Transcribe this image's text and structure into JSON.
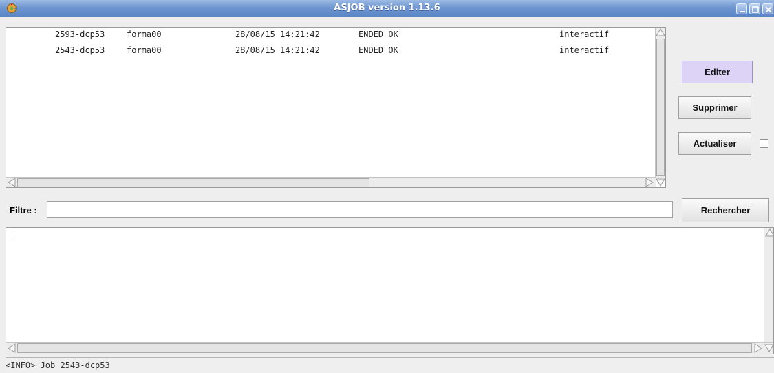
{
  "window": {
    "title": "ASJOB version 1.13.6",
    "controls": [
      "minimize-icon",
      "maximize-icon",
      "close-icon"
    ]
  },
  "jobs": [
    {
      "id": "2593-dcp53",
      "user": "forma00",
      "date": "28/08/15 14:21:42",
      "status": "ENDED OK",
      "mode": "interactif"
    },
    {
      "id": "2543-dcp53",
      "user": "forma00",
      "date": "28/08/15 14:21:42",
      "status": "ENDED OK",
      "mode": "interactif"
    }
  ],
  "actions": {
    "edit": "Editer",
    "delete": "Supprimer",
    "refresh": "Actualiser"
  },
  "filter": {
    "label": "Filtre :",
    "value": "",
    "search_button": "Rechercher"
  },
  "output": {
    "text": ""
  },
  "status_bar": {
    "message": "<INFO> Job 2543-dcp53"
  },
  "colors": {
    "titlebar": "#6f96d0",
    "primary_button": "#dcd3f6"
  }
}
